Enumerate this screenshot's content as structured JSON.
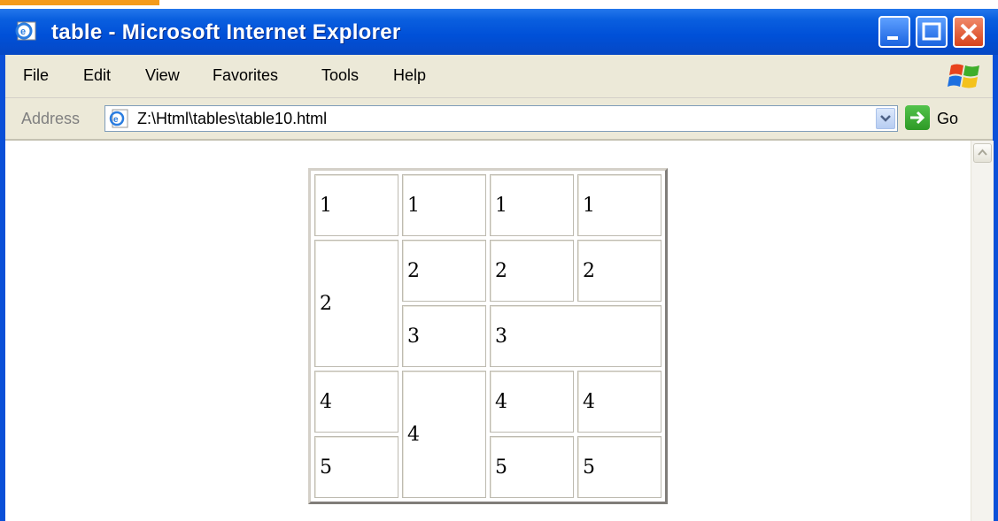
{
  "window": {
    "title": "table - Microsoft Internet Explorer"
  },
  "menu": {
    "items": [
      "File",
      "Edit",
      "View",
      "Favorites",
      "Tools",
      "Help"
    ]
  },
  "address_bar": {
    "label": "Address",
    "value": "Z:\\Html\\tables\\table10.html",
    "go_label": "Go"
  },
  "table": {
    "r1": [
      "1",
      "1",
      "1",
      "1"
    ],
    "r2": [
      "2",
      "2",
      "2",
      "2"
    ],
    "r3": [
      "3",
      "3"
    ],
    "r4": [
      "4",
      "4",
      "4",
      "4"
    ],
    "r5": [
      "5",
      "5",
      "5"
    ]
  },
  "colors": {
    "titlebar": "#0a5fdf",
    "chrome": "#ece9d8",
    "close_button": "#d8431c"
  }
}
